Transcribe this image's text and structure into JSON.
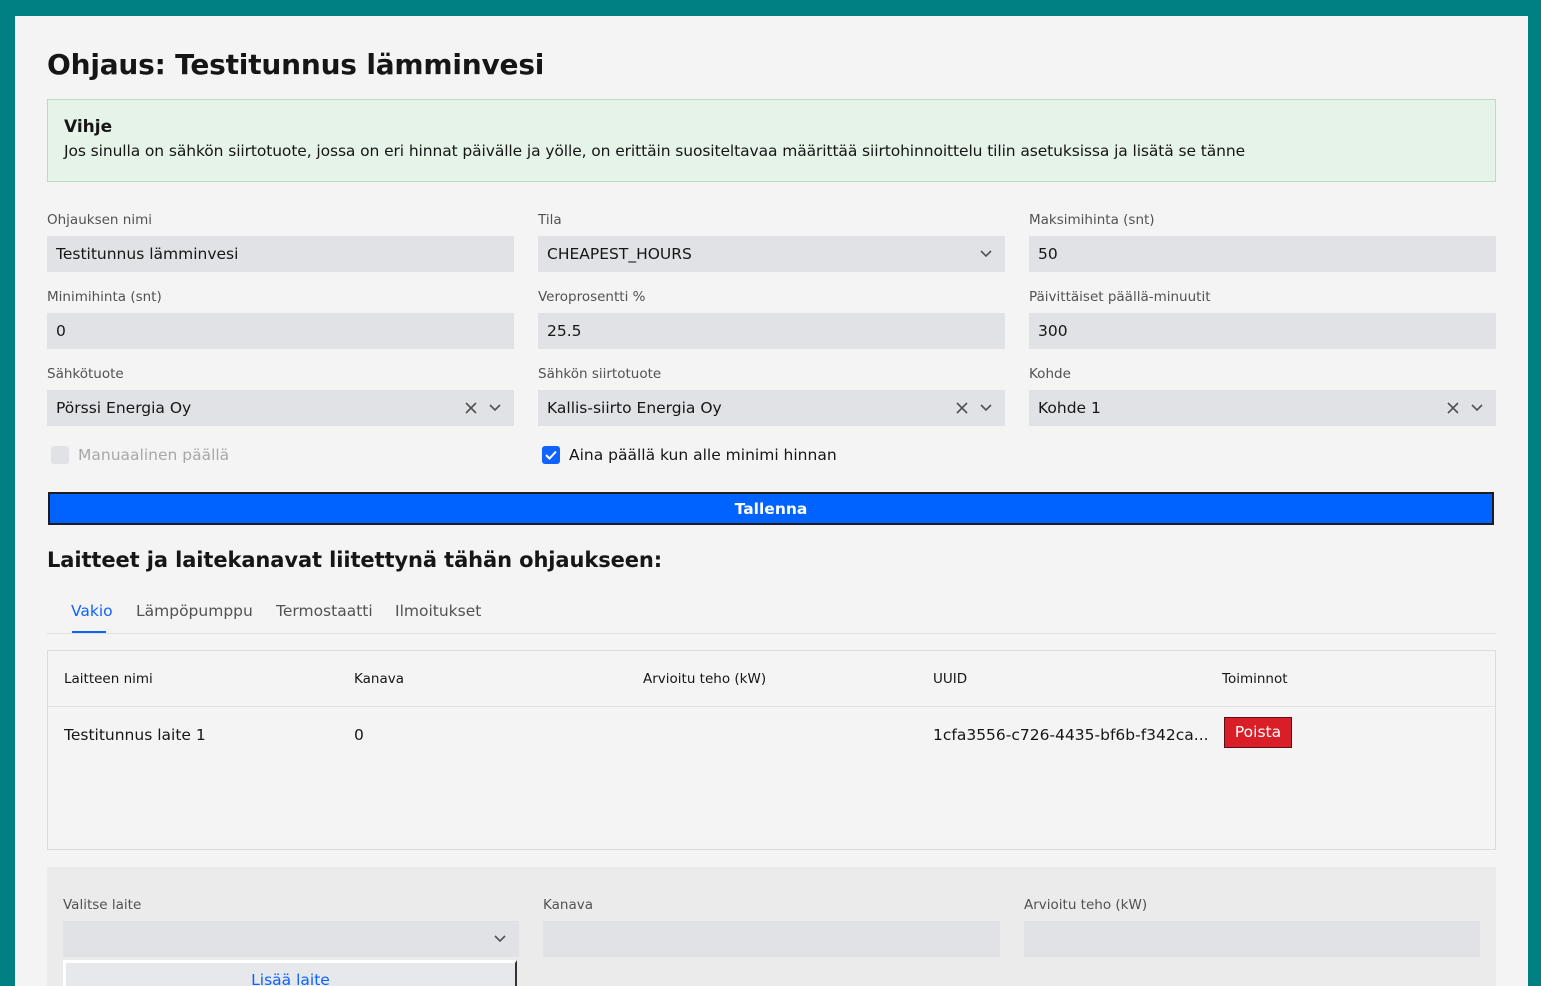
{
  "page": {
    "title": "Ohjaus: Testitunnus lämminvesi"
  },
  "hint": {
    "title": "Vihje",
    "text": "Jos sinulla on sähkön siirtotuote, jossa on eri hinnat päivälle ja yölle, on erittäin suositeltavaa määrittää siirtohinnoittelu tilin asetuksissa ja lisätä se tänne"
  },
  "form": {
    "name": {
      "label": "Ohjauksen nimi",
      "value": "Testitunnus lämminvesi"
    },
    "mode": {
      "label": "Tila",
      "value": "CHEAPEST_HOURS"
    },
    "max_price": {
      "label": "Maksimihinta (snt)",
      "value": "50"
    },
    "min_price": {
      "label": "Minimihinta (snt)",
      "value": "0"
    },
    "tax": {
      "label": "Veroprosentti %",
      "value": "25.5"
    },
    "daily_minutes": {
      "label": "Päivittäiset päällä-minuutit",
      "value": "300"
    },
    "energy_product": {
      "label": "Sähkötuote",
      "value": "Pörssi Energia Oy"
    },
    "transfer_product": {
      "label": "Sähkön siirtotuote",
      "value": "Kallis-siirto Energia Oy"
    },
    "site": {
      "label": "Kohde",
      "value": "Kohde 1"
    },
    "manual_on": {
      "label": "Manuaalinen päällä",
      "checked": false,
      "disabled": true
    },
    "always_on_below_min": {
      "label": "Aina päällä kun alle minimi hinnan",
      "checked": true
    },
    "save_label": "Tallenna"
  },
  "devices": {
    "section_title": "Laitteet ja laitekanavat liitettynä tähän ohjaukseen:",
    "tabs": [
      "Vakio",
      "Lämpöpumppu",
      "Termostaatti",
      "Ilmoitukset"
    ],
    "active_tab": "Vakio",
    "columns": [
      "Laitteen nimi",
      "Kanava",
      "Arvioitu teho (kW)",
      "UUID",
      "Toiminnot"
    ],
    "rows": [
      {
        "name": "Testitunnus laite 1",
        "channel": "0",
        "power": "",
        "uuid": "1cfa3556-c726-4435-bf6b-f342ca...",
        "action": "Poista"
      }
    ]
  },
  "add_device": {
    "device_label": "Valitse laite",
    "device_value": "",
    "channel_label": "Kanava",
    "channel_value": "",
    "power_label": "Arvioitu teho (kW)",
    "power_value": "",
    "add_label": "Lisää laite"
  },
  "colors": {
    "frame": "#008080",
    "primary": "#0062ff",
    "danger": "#da1e28",
    "hint_bg": "#e6f3e8"
  }
}
